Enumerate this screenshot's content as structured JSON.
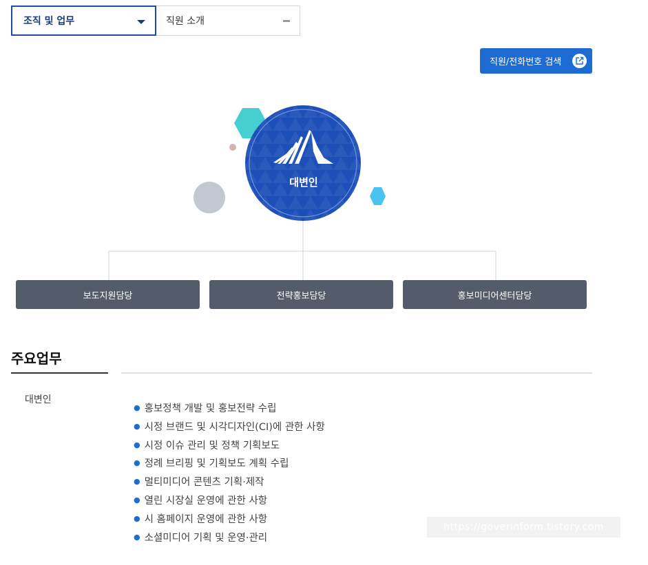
{
  "tabs": {
    "selected_label": "조직 및 업무",
    "second_label": "직원 소개"
  },
  "search_button": {
    "label": "직원/전화번호 검색"
  },
  "org_chart": {
    "head": "대변인",
    "departments": [
      "보도지원담당",
      "전략홍보담당",
      "홍보미디어센터담당"
    ],
    "colors": {
      "hub": "#1d4fb8",
      "teal_hex": "#46cfd0",
      "blue_hex": "#49c3f0",
      "gray_dot": "#c3c9d0",
      "pink_dot": "#d8b1b1",
      "dept": "#545b6a"
    }
  },
  "section": {
    "title": "주요업무",
    "unit": "대변인",
    "duties": [
      "홍보정책 개발 및 홍보전략 수립",
      "시정 브랜드 및 시각디자인(CI)에 관한 사항",
      "시정 이슈 관리 및 정책 기획보도",
      "정례 브리핑 및 기획보도 계획 수립",
      "멀티미디어 콘텐츠 기획·제작",
      "열린 시장실 운영에 관한 사항",
      "시 홈페이지 운영에 관한 사항",
      "소셜미디어 기획 및 운영·관리"
    ]
  },
  "watermark": "https://goverinform.tistory.com"
}
